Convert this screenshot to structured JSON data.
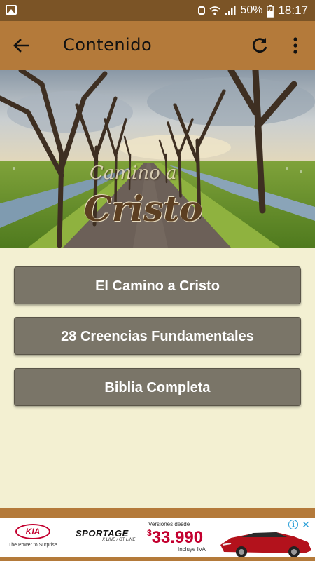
{
  "status_bar": {
    "battery_percent": "50%",
    "time": "18:17"
  },
  "app_bar": {
    "title": "Contenido"
  },
  "hero": {
    "logo_line1": "Camino a",
    "logo_line2": "Cristo"
  },
  "menu": {
    "items": [
      {
        "label": "El Camino a Cristo"
      },
      {
        "label": "28 Creencias Fundamentales"
      },
      {
        "label": "Biblia Completa"
      }
    ]
  },
  "ad": {
    "brand": "KIA",
    "tagline": "The Power to Surprise",
    "model": "SPORTAGE",
    "model_sub": "X LINE / GT LINE",
    "price_intro": "Versiones desde",
    "price_currency": "$",
    "price_value": "33.990",
    "price_note": "Incluye IVA",
    "info_icon": "i",
    "close_icon": "✕"
  },
  "colors": {
    "status_bar": "#7b5426",
    "app_bar": "#b47a3a",
    "background": "#f3f0d2",
    "button": "#7a7568"
  }
}
